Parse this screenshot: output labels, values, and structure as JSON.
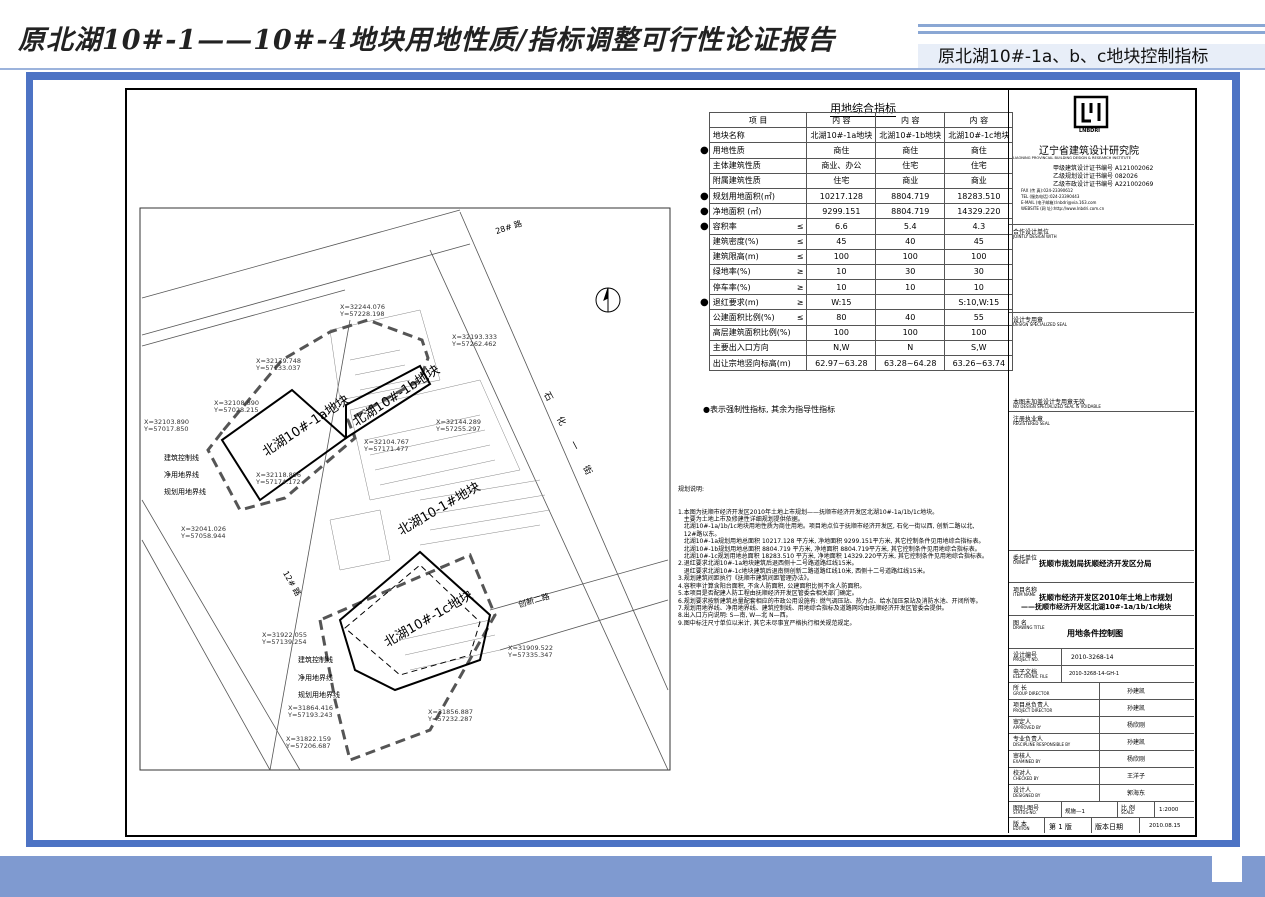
{
  "slide": {
    "title": "原北湖10#-1——10#-4地块用地性质/指标调整可行性论证报告",
    "subtitle": "原北湖10#-1a、b、c地块控制指标"
  },
  "table": {
    "title": "用地综合指标",
    "header": [
      "项    目",
      "内    容",
      "内    容",
      "内    容"
    ],
    "rows": [
      {
        "dot": "",
        "label": "地块名称",
        "op": "",
        "v": [
          "北湖10#-1a地块",
          "北湖10#-1b地块",
          "北湖10#-1c地块"
        ]
      },
      {
        "dot": "●",
        "label": "用地性质",
        "op": "",
        "v": [
          "商住",
          "商住",
          "商住"
        ]
      },
      {
        "dot": "",
        "label": "主体建筑性质",
        "op": "",
        "v": [
          "商业、办公",
          "住宅",
          "住宅"
        ]
      },
      {
        "dot": "",
        "label": "附属建筑性质",
        "op": "",
        "v": [
          "住宅",
          "商业",
          "商业"
        ]
      },
      {
        "dot": "●",
        "label": "规划用地面积(㎡)",
        "op": "",
        "v": [
          "10217.128",
          "8804.719",
          "18283.510"
        ]
      },
      {
        "dot": "●",
        "label": "净地面积 (㎡)",
        "op": "",
        "v": [
          "9299.151",
          "8804.719",
          "14329.220"
        ]
      },
      {
        "dot": "●",
        "label": "容积率",
        "op": "≤",
        "v": [
          "6.6",
          "5.4",
          "4.3"
        ]
      },
      {
        "dot": "",
        "label": "建筑密度(%)",
        "op": "≤",
        "v": [
          "45",
          "40",
          "45"
        ]
      },
      {
        "dot": "",
        "label": "建筑限高(m)",
        "op": "≤",
        "v": [
          "100",
          "100",
          "100"
        ]
      },
      {
        "dot": "",
        "label": "绿地率(%)",
        "op": "≥",
        "v": [
          "10",
          "30",
          "30"
        ]
      },
      {
        "dot": "",
        "label": "停车率(%)",
        "op": "≥",
        "v": [
          "10",
          "10",
          "10"
        ]
      },
      {
        "dot": "●",
        "label": "退红要求(m)",
        "op": "≥",
        "v": [
          "W:15",
          "",
          "S:10,W:15"
        ]
      },
      {
        "dot": "",
        "label": "公建面积比例(%)",
        "op": "≤",
        "v": [
          "80",
          "40",
          "55"
        ]
      },
      {
        "dot": "",
        "label": "高层建筑面积比例(%)",
        "op": "",
        "v": [
          "100",
          "100",
          "100"
        ]
      },
      {
        "dot": "",
        "label": "主要出入口方向",
        "op": "",
        "v": [
          "N,W",
          "N",
          "S,W"
        ]
      },
      {
        "dot": "",
        "label": "出让宗地竖向标高(m)",
        "op": "",
        "v": [
          "62.97~63.28",
          "63.28~64.28",
          "63.26~63.74"
        ]
      }
    ],
    "footnote": "●表示强制性指标, 其余为指导性指标"
  },
  "notes": {
    "title": "规划说明:",
    "lines": [
      "1.本图为抚顺市经济开发区2010年土地上市规划——抚顺市经济开发区北湖10#-1a/1b/1c地块。",
      "   主要为土地上市及修建性详细规划提供依据。",
      "   北湖10#-1a/1b/1c地块用地性质为商住用地。项目地点位于抚顺市经济开发区, 石化一街以西, 创新二路以北,",
      "   12#路以东。",
      "   北湖10#-1a规划用地总面积 10217.128 平方米, 净地面积 9299.151平方米, 其它控制条件见用地综合指标表。",
      "   北湖10#-1b规划用地总面积 8804.719 平方米, 净地面积 8804.719平方米, 其它控制条件见用地综合指标表。",
      "   北湖10#-1c规划用地总面积 18283.510 平方米, 净地面积 14329.220平方米, 其它控制条件见用地综合指标表。",
      "2.退红要求北湖10#-1a地块建筑后退西侧十二号路道路红线15米。",
      "   退红要求北湖10#-1c地块建筑后退南侧创新二路道路红线10米, 西侧十二号道路红线15米。",
      "3.规划建筑间距执行《抚顺市建筑间距管理办法》。",
      "4.容积率计算含阳台面积, 不含人防面积, 公建面积比例不含人防面积。",
      "5.本项目是否配建人防工程由抚顺经济开发区管委会相关部门确定。",
      "6.规划要求按新建筑总量配套相应的市政公用设施有: 燃气调压站、热力点、给水加压泵站及消防水池、开闭所等。",
      "7.规划用地界线、净用地界线、建筑控制线、用地综合指标及道路网均由抚顺经济开发区管委会提供。",
      "8.出入口方向说明: S—南, W—北 N—西。",
      "9.图中标注尺寸单位以米计, 其它未尽事宜严格执行相关规范规定。"
    ]
  },
  "map": {
    "parcel_1a": "北湖10#-1a地块",
    "parcel_1b": "北湖10#-1b地块",
    "parcel_1": "北湖10-1#地块",
    "parcel_1c": "北湖10#-1c地块",
    "road_28": "28# 路",
    "road_12": "12# 路",
    "road_shihua": "石 化 一 街",
    "road_chuangxin": "创新二路",
    "legend_1": [
      "建筑控制线",
      "净用地界线",
      "规划用地界线"
    ],
    "legend_2": [
      "建筑控制线",
      "净用地界线",
      "规划用地界线"
    ],
    "coords": [
      "X=32244.076",
      "Y=57228.198",
      "X=32193.333",
      "Y=57262.462",
      "X=32179.748",
      "Y=57133.037",
      "X=32108.890",
      "Y=57028.215",
      "X=32103.890",
      "Y=57017.850",
      "X=32144.289",
      "Y=57255.297",
      "X=32104.767",
      "Y=57171.477",
      "X=32118.896",
      "Y=57174.172",
      "X=32041.026",
      "Y=57058.944",
      "X=31922.055",
      "Y=57139.254",
      "X=31909.522",
      "Y=57335.347",
      "X=31864.416",
      "Y=57193.243",
      "X=31856.887",
      "Y=57232.287",
      "X=31822.159",
      "Y=57206.687"
    ]
  },
  "titleblock": {
    "logo_text": "LNBDRI",
    "institute": "辽宁省建筑设计研究院",
    "institute_en": "LIAONING PROVINCIAL BUILDING DESIGN & RESEARCH INSTITUTE",
    "cert_lines": [
      "甲级建筑设计证书编号 A121002062",
      "乙级规划设计证书编号 082026",
      "乙级市政设计证书编号 A221002069"
    ],
    "contact_lines": [
      "FAX  (传  真):024-23390612",
      "TEL  (服务电话):024-23390443",
      "E-MAIL (电子邮箱):lnbdri@via.163.com",
      "WEBSITE (网  址):http://www.lnbdri.com.cn"
    ],
    "joint": "合作设计单位",
    "joint_en": "JOINTLY DESIGN WITH",
    "seal": "设计专用章",
    "seal_en": "DESIGN SPECIALIZED SEAL",
    "void": "本图未加盖设计专用章无效",
    "void_en": "NO DESIGN SPECIALIZED SEAL IS VOIDABLE",
    "reg": "注册执业章",
    "reg_en": "REGISTERED SEAL",
    "owner_label": "委托单位",
    "owner_en": "OWNER",
    "owner": "抚顺市规划局抚顺经济开发区分局",
    "item_label": "项目名称",
    "item_en": "ITEM NAME",
    "item_1": "抚顺市经济开发区2010年土地上市规划",
    "item_2": "——抚顺市经济开发区北湖10#-1a/1b/1c地块",
    "drawing_label": "图  名",
    "drawing_en": "DRAWING TITLE",
    "drawing": "用地条件控制图",
    "proj_label": "设计编号",
    "proj_en": "PROJECT NO.",
    "proj": "2010-3268-14",
    "file_label": "电子文档",
    "file_en": "ELECTRONIC FILE",
    "file": "2010-3268-14-GH-1",
    "staff": [
      {
        "role": "所  长",
        "en": "GROUP DIRECTOR",
        "name": "孙建凯"
      },
      {
        "role": "项目总负责人",
        "en": "PROJECT DIRECTOR",
        "name": "孙建凯"
      },
      {
        "role": "审定人",
        "en": "APPROVED BY",
        "name": "杨欣刚"
      },
      {
        "role": "专业负责人",
        "en": "DISCIPLINE RESPONSIBLE BY",
        "name": "孙建凯"
      },
      {
        "role": "审核人",
        "en": "EXAMINED BY",
        "name": "杨欣刚"
      },
      {
        "role": "校对人",
        "en": "CHECKED BY",
        "name": "王洋子"
      },
      {
        "role": "设计人",
        "en": "DESIGNED BY",
        "name": "郭海东"
      }
    ],
    "status_label": "图别-图号",
    "status_en": "STATUS-NO.",
    "status": "规施—1",
    "scale_label": "比  例",
    "scale_en": "SCALE",
    "scale": "1:2000",
    "edition_label": "版  本",
    "edition_en": "EDITION",
    "edition": "第 1 版",
    "date_label": "版本日期",
    "date": "2010.08.15"
  }
}
